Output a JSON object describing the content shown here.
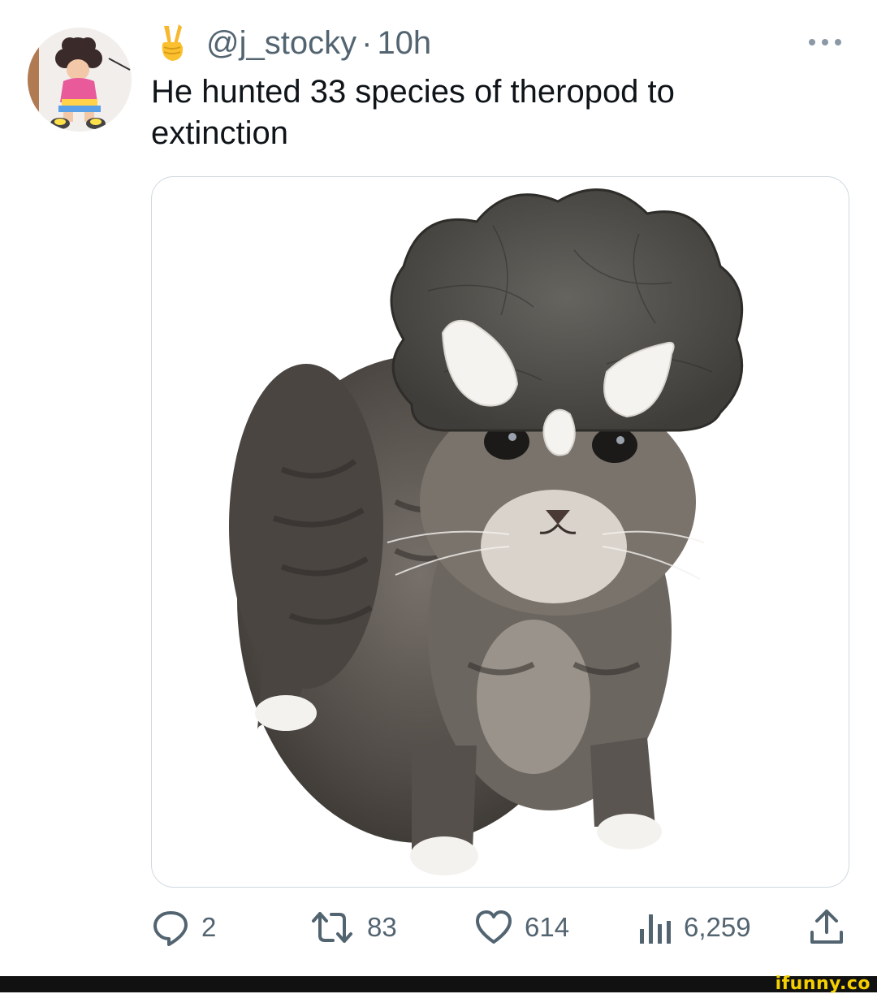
{
  "tweet": {
    "handle": "@j_stocky",
    "separator": "·",
    "time": "10h",
    "text": "He hunted 33 species of theropod to extinction",
    "emoji_icon": "victory-hand-icon",
    "avatar_icon": "cartoon-character-avatar"
  },
  "media": {
    "subject_icon": "cat-wearing-triceratops-hat"
  },
  "actions": {
    "replies": "2",
    "retweets": "83",
    "likes": "614",
    "views": "6,259",
    "icons": [
      "reply-icon",
      "retweet-icon",
      "like-icon",
      "views-icon",
      "share-icon"
    ]
  },
  "footer": {
    "watermark": "ifunny.co"
  },
  "colors": {
    "text": "#0f1419",
    "muted": "#536471",
    "border": "#cfd9de",
    "watermark": "#f5d000"
  }
}
